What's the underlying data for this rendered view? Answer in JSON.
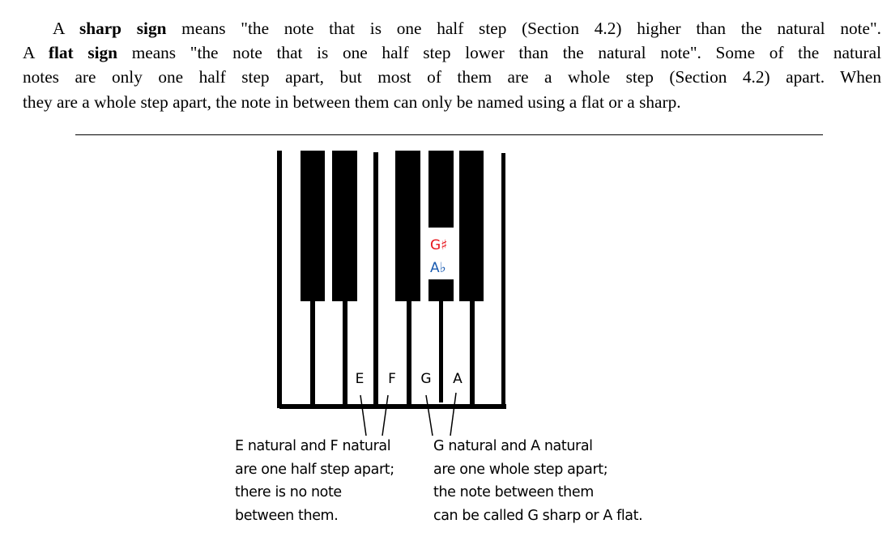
{
  "paragraph": {
    "line1_pre": "A ",
    "line1_bold": "sharp sign",
    "line1_post": " means \"the note that is one half step (Section 4.2) higher than the natural note\".",
    "line2_pre": "A ",
    "line2_bold": "flat sign",
    "line2_post": " means \"the note that is one half step lower than the natural note\". Some of the natural",
    "line3": "notes are only one half step apart, but most of them are a whole step (Section 4.2) apart. When",
    "line4": "they are a whole step apart, the note in between them can only be named using a flat or a sharp."
  },
  "figure": {
    "key_labels": [
      "E",
      "F",
      "G",
      "A"
    ],
    "sharp_label": "G♯",
    "flat_label": "A♭",
    "colors": {
      "sharp": "#e8141b",
      "flat": "#1a5bb0"
    },
    "caption_left": [
      "E natural and F natural",
      "are one half step apart;",
      "there is no note",
      "between them."
    ],
    "caption_right": [
      "G natural and A natural",
      "are one whole step apart;",
      "the note between them",
      "can be called G sharp or A flat."
    ]
  }
}
